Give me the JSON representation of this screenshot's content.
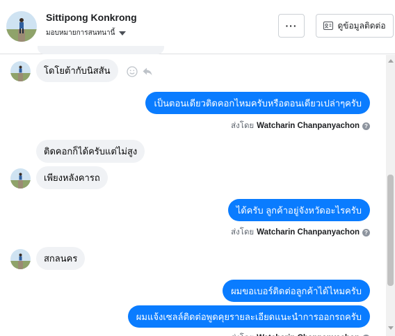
{
  "header": {
    "contact_name": "Sittipong Konkrong",
    "assign_label": "มอบหมายการสนทนานี้",
    "more_label": "···",
    "view_info_label": "ดูข้อมูลติดต่อ"
  },
  "messages": [
    {
      "dir": "in",
      "text": "โดโยต้ากับนิสสัน",
      "avatar": true
    },
    {
      "dir": "out",
      "text": "เป็นตอนเดียวติดคอกไหมครับหรือตอนเดียวเปล่าๆครับ"
    },
    {
      "dir": "in",
      "text": "ติดคอกก็ได้ครับแต่ไม่สูง",
      "avatar": false
    },
    {
      "dir": "in",
      "text": "เพียงหลังคารถ",
      "avatar": true
    },
    {
      "dir": "out",
      "text": "ได้ครับ ลูกค้าอยู่จังหวัดอะไรครับ"
    },
    {
      "dir": "in",
      "text": "สกลนคร",
      "avatar": true
    },
    {
      "dir": "out",
      "text": "ผมขอเบอร์ติดต่อลูกค้าได้ไหมครับ"
    },
    {
      "dir": "out",
      "text": "ผมแจ้งเซลล์ติดต่อพูดคุยรายละเอียดแนะนำการออกรถครับ"
    }
  ],
  "sent_by": {
    "prefix": "ส่งโดย",
    "agent": "Watcharin Chanpanyachon",
    "help": "?"
  },
  "icons": {
    "react": "smiley-icon",
    "reply": "reply-icon"
  },
  "colors": {
    "outgoing_bubble": "#0a7cff",
    "incoming_bubble": "#f0f2f5"
  }
}
